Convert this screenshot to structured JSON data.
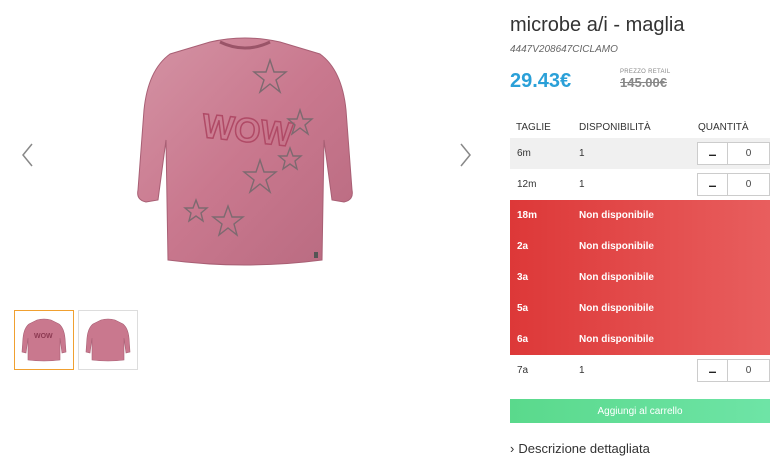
{
  "product": {
    "title": "microbe a/i - maglia",
    "sku": "4447V208647CICLAMO",
    "price": "29.43€",
    "retail_label": "PREZZO RETAIL",
    "retail_price": "145.00€",
    "image_graphic_text": "WOW"
  },
  "table": {
    "headers": {
      "size": "TAGLIE",
      "availability": "DISPONIBILITÀ",
      "quantity": "QUANTITÀ"
    },
    "rows": [
      {
        "size": "6m",
        "availability": "1",
        "qty": "0"
      },
      {
        "size": "12m",
        "availability": "1",
        "qty": "0"
      },
      {
        "size": "18m",
        "availability": "Non disponibile"
      },
      {
        "size": "2a",
        "availability": "Non disponibile"
      },
      {
        "size": "3a",
        "availability": "Non disponibile"
      },
      {
        "size": "5a",
        "availability": "Non disponibile"
      },
      {
        "size": "6a",
        "availability": "Non disponibile"
      },
      {
        "size": "7a",
        "availability": "1",
        "qty": "0"
      }
    ]
  },
  "cart_button": "Aggiungi al carrello",
  "description_link": "Descrizione dettagliata",
  "colors": {
    "accent_price": "#2aa0d8",
    "unavailable": "#e04444",
    "cart": "#5ad98c",
    "thumb_active": "#f0a030",
    "garment": "#c9788e"
  }
}
